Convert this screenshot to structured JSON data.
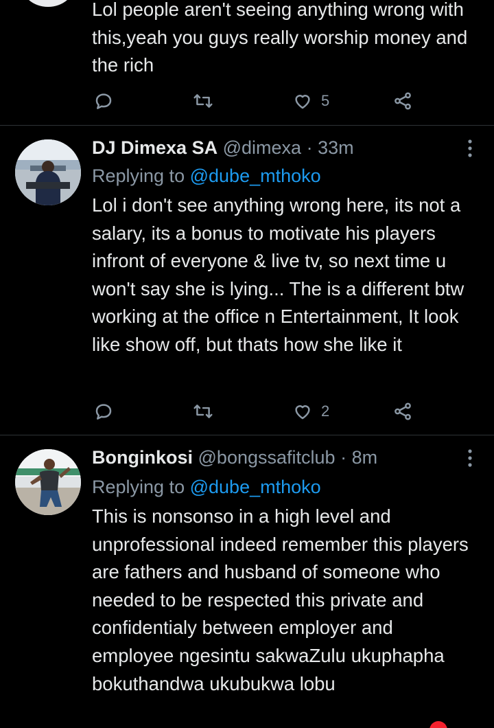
{
  "tweets": [
    {
      "body": "Lol people aren't seeing anything wrong with this,yeah you guys really worship money and the rich",
      "likes": "5"
    },
    {
      "name": "DJ Dimexa SA",
      "handle": "@dimexa",
      "dot": "·",
      "time": "33m",
      "replying_prefix": "Replying to",
      "replying_to": "@dube_mthoko",
      "body": "Lol i don't see anything wrong here, its not a salary, its a bonus to motivate his players infront of everyone & live tv, so next time u won't say she is lying... The is a different btw working at the office n Entertainment, It look like show off, but thats how she like it",
      "likes": "2"
    },
    {
      "name": "Bonginkosi",
      "handle": "@bongssafitclub",
      "dot": "·",
      "time": "8m",
      "replying_prefix": "Replying to",
      "replying_to": "@dube_mthoko",
      "body": "This is nonsonso in a high level and unprofessional indeed remember this players are fathers and husband of someone who needed to be respected this private and confidentialy between employer and employee ngesintu sakwaZulu ukuphapha bokuthandwa ukubukwa lobu"
    }
  ],
  "icons": {
    "reply": "reply-icon",
    "retweet": "retweet-icon",
    "like": "heart-icon",
    "share": "share-icon",
    "more": "more-icon"
  },
  "colors": {
    "background": "#000000",
    "text": "#e7e9ea",
    "secondary": "#8b98a5",
    "link": "#1d9bf0",
    "divider": "#2f3336"
  }
}
